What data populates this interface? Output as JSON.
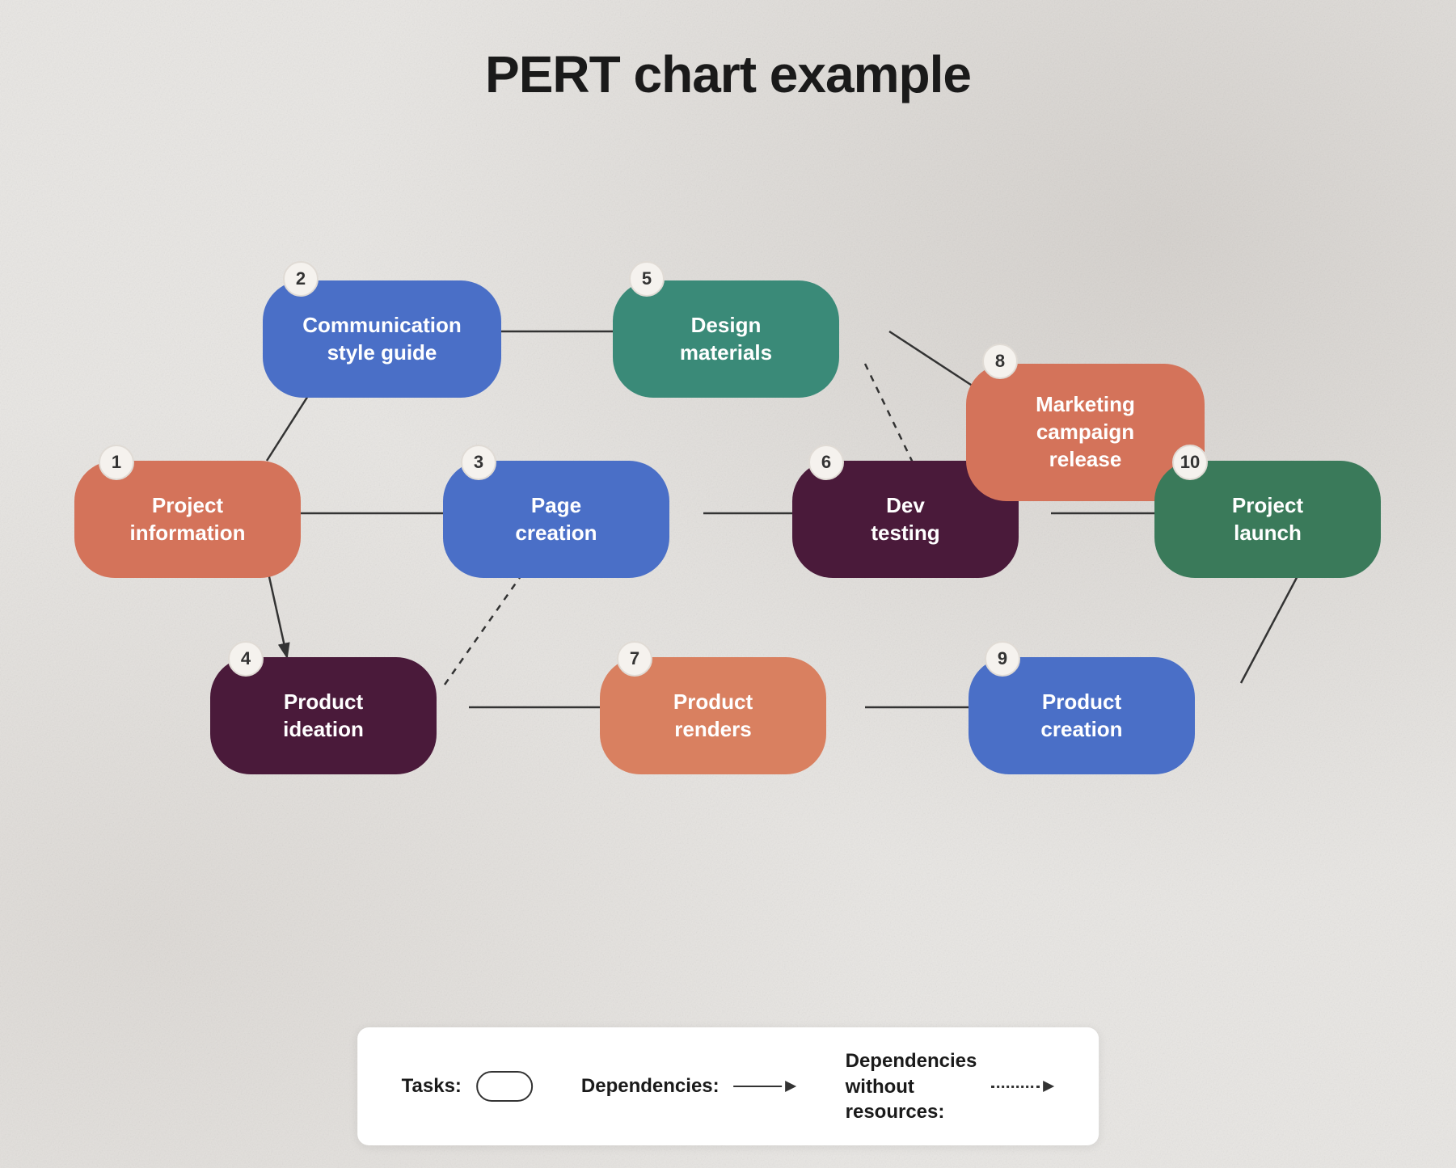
{
  "title": "PERT chart example",
  "nodes": [
    {
      "id": 1,
      "label": "Project\ninformation",
      "color": "salmon",
      "badge": "1"
    },
    {
      "id": 2,
      "label": "Communication\nstyle guide",
      "color": "blue",
      "badge": "2"
    },
    {
      "id": 3,
      "label": "Page\ncreation",
      "color": "blue",
      "badge": "3"
    },
    {
      "id": 4,
      "label": "Product\nideation",
      "color": "dark-purple",
      "badge": "4"
    },
    {
      "id": 5,
      "label": "Design\nmaterials",
      "color": "teal",
      "badge": "5"
    },
    {
      "id": 6,
      "label": "Dev\ntesting",
      "color": "dark-purple",
      "badge": "6"
    },
    {
      "id": 7,
      "label": "Product\nrenders",
      "color": "orange-salmon",
      "badge": "7"
    },
    {
      "id": 8,
      "label": "Marketing\ncampaign\nrelease",
      "color": "salmon",
      "badge": "8"
    },
    {
      "id": 9,
      "label": "Product\ncreation",
      "color": "blue",
      "badge": "9"
    },
    {
      "id": 10,
      "label": "Project\nlaunch",
      "color": "green",
      "badge": "10"
    }
  ],
  "legend": {
    "tasks_label": "Tasks:",
    "dependencies_label": "Dependencies:",
    "dependencies_without_label": "Dependencies\nwithout resources:"
  }
}
